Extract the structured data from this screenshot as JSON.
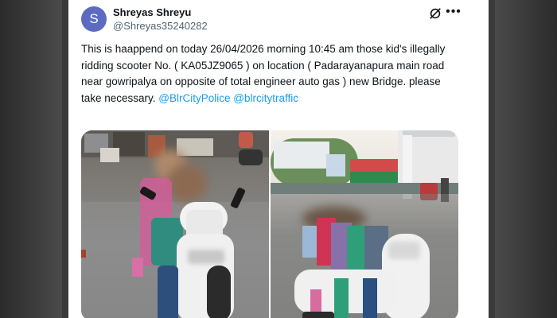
{
  "user": {
    "avatar_initial": "S",
    "display_name": "Shreyas Shreyu",
    "handle": "@Shreyas35240282"
  },
  "post": {
    "text": "This is haappend on today 26/04/2026 morning 10:45 am those kid's illegally   ridding scooter No. ( KA05JZ9065 ) on location ( Padarayanapura main road near gowripalya on  opposite of total engineer auto gas ) new Bridge. please take necessary. ",
    "mentions": [
      "@BlrCityPolice",
      "@blrcitytraffic"
    ]
  },
  "icons": {
    "grok": "grok-icon",
    "more": "more-options-icon"
  },
  "colors": {
    "avatar": "#5c6bc0",
    "mention": "#1d9bf0",
    "text": "#0f1419",
    "secondary": "#536471"
  }
}
